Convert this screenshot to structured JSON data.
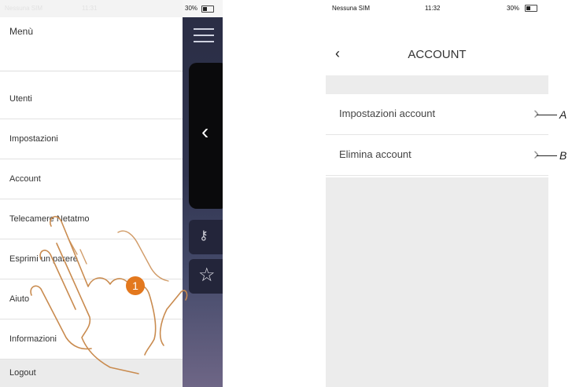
{
  "left_screen": {
    "status": {
      "carrier": "Nessuna SIM",
      "time": "11:31",
      "battery": "30%"
    },
    "menu_title": "Menù",
    "menu_items": [
      {
        "label": "Utenti"
      },
      {
        "label": "Impostazioni"
      },
      {
        "label": "Account"
      },
      {
        "label": "Telecamere Netatmo"
      },
      {
        "label": "Esprimi un parere"
      },
      {
        "label": "Aiuto"
      },
      {
        "label": "Informazioni"
      }
    ],
    "logout_label": "Logout",
    "step_badge": "1",
    "icons": [
      "hamburger-icon",
      "chevron-left-icon",
      "key-icon",
      "star-icon"
    ]
  },
  "right_screen": {
    "status": {
      "carrier": "Nessuna SIM",
      "time": "11:32",
      "battery": "30%"
    },
    "title": "ACCOUNT",
    "rows": [
      {
        "label": "Impostazioni account",
        "callout": "A"
      },
      {
        "label": "Elimina account",
        "callout": "B"
      }
    ],
    "icons": [
      "back-chevron-icon",
      "row-chevron-icon"
    ]
  },
  "colors": {
    "badge": "#e3781e",
    "dark_panel": "#2a2d44"
  }
}
